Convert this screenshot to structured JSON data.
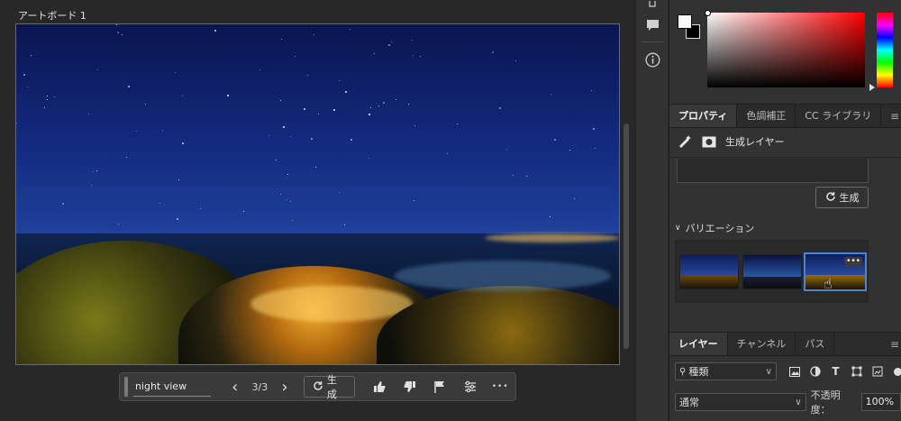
{
  "canvas": {
    "artboard_label": "アートボード 1"
  },
  "taskbar": {
    "prompt_value": "night view",
    "prev_label": "‹",
    "next_label": "›",
    "counter": "3/3",
    "generate_label": "生成",
    "more_label": "•••"
  },
  "rail": {},
  "color_panel": {
    "foreground": "#ffffff",
    "background": "#000000",
    "hue": "#ff0000"
  },
  "properties_panel": {
    "tabs": [
      "プロパティ",
      "色調補正",
      "CC ライブラリ"
    ],
    "active_tab": "プロパティ",
    "layer_type": "生成レイヤー",
    "generate_label": "生成",
    "variations_title": "バリエーション",
    "variations_count_selected": 3
  },
  "layers_panel": {
    "tabs": [
      "レイヤー",
      "チャンネル",
      "パス"
    ],
    "kind_filter": "種類",
    "blend_mode": "通常",
    "opacity_label": "不透明度：",
    "opacity_value": "100%"
  },
  "accent_color": "#4b84d2"
}
